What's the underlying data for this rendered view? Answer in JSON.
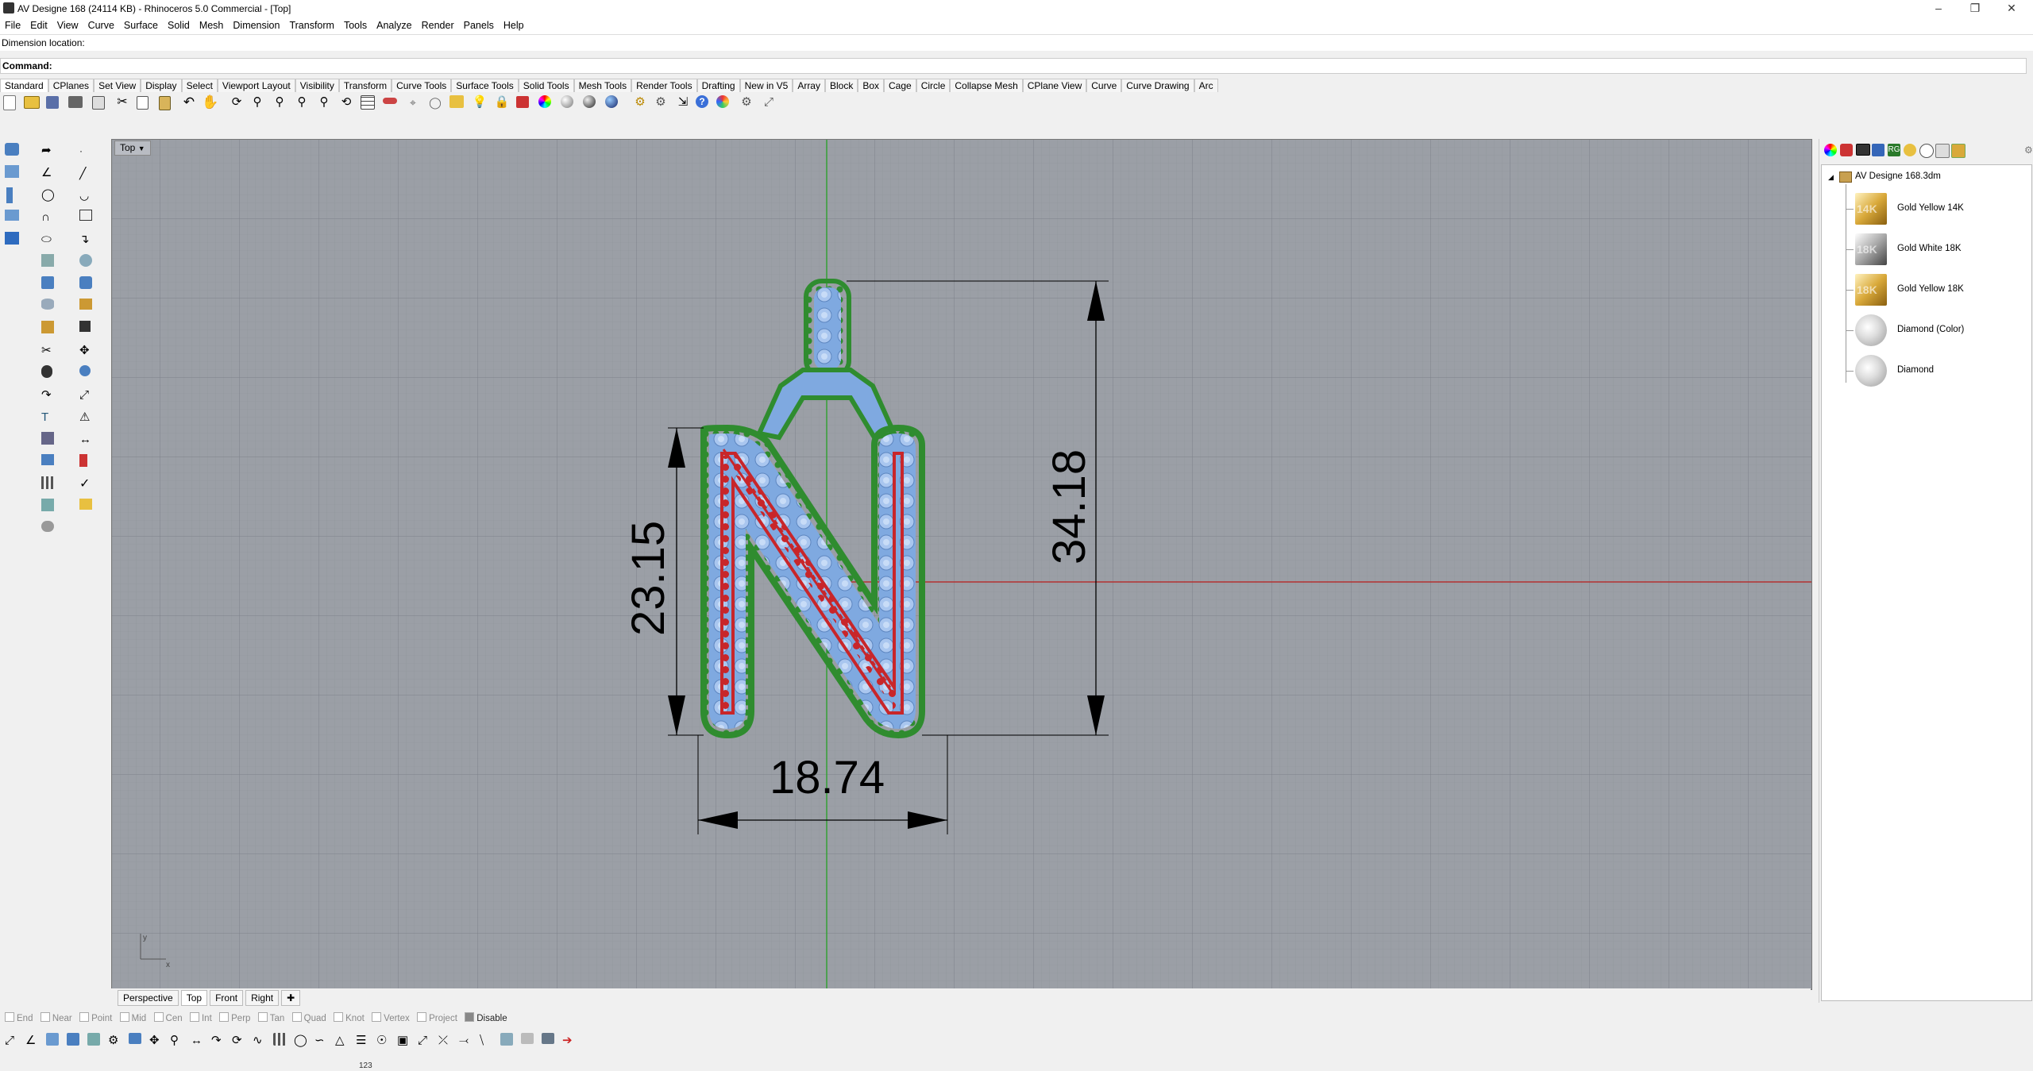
{
  "window": {
    "title": "AV Designe 168 (24114 KB) - Rhinoceros 5.0 Commercial - [Top]"
  },
  "menu": [
    "File",
    "Edit",
    "View",
    "Curve",
    "Surface",
    "Solid",
    "Mesh",
    "Dimension",
    "Transform",
    "Tools",
    "Analyze",
    "Render",
    "Panels",
    "Help"
  ],
  "command": {
    "history": "Dimension location:",
    "prompt_label": "Command:",
    "value": ""
  },
  "toolbar_tabs": [
    "Standard",
    "CPlanes",
    "Set View",
    "Display",
    "Select",
    "Viewport Layout",
    "Visibility",
    "Transform",
    "Curve Tools",
    "Surface Tools",
    "Solid Tools",
    "Mesh Tools",
    "Render Tools",
    "Drafting",
    "New in V5",
    "Array",
    "Block",
    "Box",
    "Cage",
    "Circle",
    "Collapse Mesh",
    "CPlane View",
    "Curve",
    "Curve Drawing",
    "Arc"
  ],
  "viewport": {
    "name": "Top",
    "dimensions": {
      "height_left": "23.15",
      "height_right": "34.18",
      "width_bottom": "18.74"
    },
    "axis_y": "y",
    "axis_x": "x"
  },
  "viewport_tabs": [
    "Perspective",
    "Top",
    "Front",
    "Right"
  ],
  "osnaps": [
    {
      "label": "End",
      "on": false
    },
    {
      "label": "Near",
      "on": false
    },
    {
      "label": "Point",
      "on": false
    },
    {
      "label": "Mid",
      "on": false
    },
    {
      "label": "Cen",
      "on": false
    },
    {
      "label": "Int",
      "on": false
    },
    {
      "label": "Perp",
      "on": false
    },
    {
      "label": "Tan",
      "on": false
    },
    {
      "label": "Quad",
      "on": false
    },
    {
      "label": "Knot",
      "on": false
    },
    {
      "label": "Vertex",
      "on": false
    },
    {
      "label": "Project",
      "on": false
    },
    {
      "label": "Disable",
      "on": true
    }
  ],
  "panel": {
    "file_name": "AV Designe 168.3dm",
    "materials": [
      {
        "name": "Gold Yellow 14K",
        "tag": "14K",
        "color": "#d9a93a"
      },
      {
        "name": "Gold White 18K",
        "tag": "18K",
        "color": "#a8a8a8"
      },
      {
        "name": "Gold Yellow 18K",
        "tag": "18K",
        "color": "#d9a93a"
      },
      {
        "name": "Diamond (Color)",
        "tag": "",
        "color": "#e6e6e6"
      },
      {
        "name": "Diamond",
        "tag": "",
        "color": "#e6e6e6"
      }
    ]
  },
  "bottom_status": "123"
}
